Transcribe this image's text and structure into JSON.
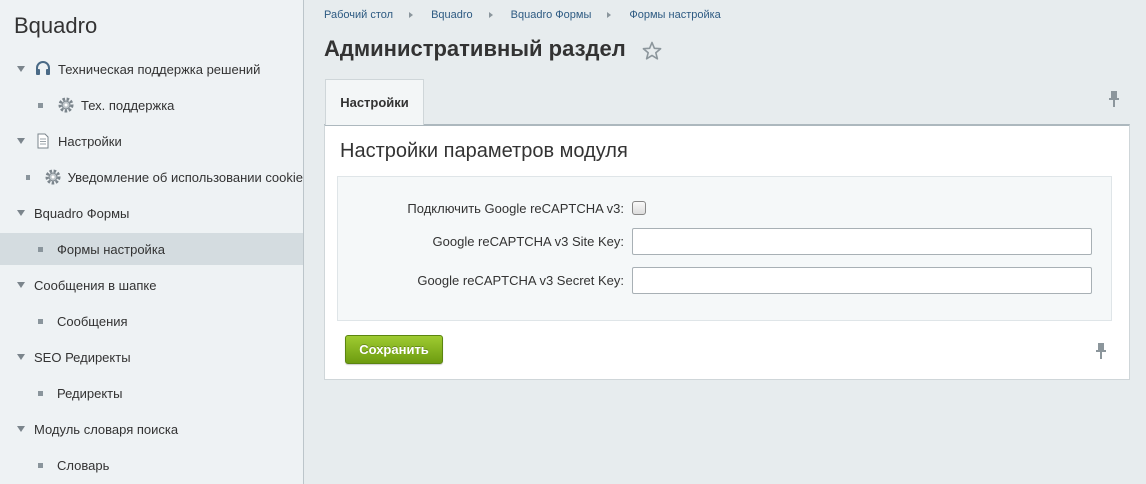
{
  "sidebar": {
    "brand": "Bquadro",
    "items": [
      {
        "label": "Техническая поддержка решений",
        "icon": "headset-icon"
      },
      {
        "label": "Тех. поддержка",
        "icon": "gear-icon"
      },
      {
        "label": "Настройки",
        "icon": "document-icon"
      },
      {
        "label": "Уведомление об использовании cookie",
        "icon": "gear-icon"
      },
      {
        "label": "Bquadro Формы"
      },
      {
        "label": "Формы настройка",
        "active": true
      },
      {
        "label": "Сообщения в шапке"
      },
      {
        "label": "Сообщения"
      },
      {
        "label": "SEO Редиректы"
      },
      {
        "label": "Редиректы"
      },
      {
        "label": "Модуль словаря поиска"
      },
      {
        "label": "Словарь"
      }
    ]
  },
  "breadcrumbs": [
    "Рабочий стол",
    "Bquadro",
    "Bquadro Формы",
    "Формы настройка"
  ],
  "page": {
    "title": "Административный раздел",
    "tab_label": "Настройки",
    "section_title": "Настройки параметров модуля"
  },
  "form": {
    "recaptcha_enable_label": "Подключить Google reCAPTCHA v3:",
    "recaptcha_enable_checked": false,
    "site_key_label": "Google reCAPTCHA v3 Site Key:",
    "site_key_value": "",
    "secret_key_label": "Google reCAPTCHA v3 Secret Key:",
    "secret_key_value": "",
    "save_label": "Сохранить"
  },
  "colors": {
    "accent_button": "#85b622",
    "link": "#2d5a82",
    "active_menu_bg": "#d4dce0"
  }
}
